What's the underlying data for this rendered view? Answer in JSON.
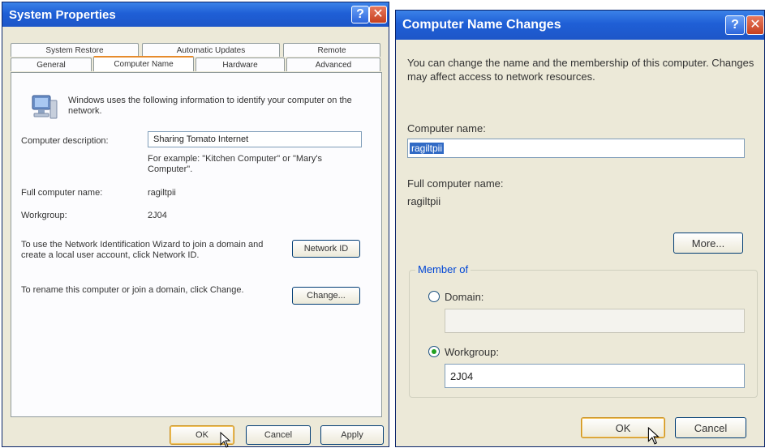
{
  "left_window": {
    "title": "System Properties",
    "tabs_row1": [
      "System Restore",
      "Automatic Updates",
      "Remote"
    ],
    "tabs_row2": [
      "General",
      "Computer Name",
      "Hardware",
      "Advanced"
    ],
    "intro_text": "Windows uses the following information to identify your computer on the network.",
    "desc_label": "Computer description:",
    "desc_value": "Sharing Tomato Internet",
    "desc_example": "For example: \"Kitchen Computer\" or \"Mary's Computer\".",
    "fullname_label": "Full computer name:",
    "fullname_value": "ragiltpii",
    "workgroup_label": "Workgroup:",
    "workgroup_value": "2J04",
    "network_text": "To use the Network Identification Wizard to join a domain and create a local user account, click Network ID.",
    "network_button": "Network ID",
    "rename_text": "To rename this computer or join a domain, click Change.",
    "change_button": "Change...",
    "ok": "OK",
    "cancel": "Cancel",
    "apply": "Apply"
  },
  "right_window": {
    "title": "Computer Name Changes",
    "intro_text": "You can change the name and the membership of this computer. Changes may affect access to network resources.",
    "name_label": "Computer name:",
    "name_value": "ragiltpii",
    "fullname_label": "Full computer name:",
    "fullname_value": "ragiltpii",
    "more_button": "More...",
    "member_of": "Member of",
    "domain_label": "Domain:",
    "domain_value": "",
    "workgroup_label": "Workgroup:",
    "workgroup_value": "2J04",
    "ok": "OK",
    "cancel": "Cancel"
  }
}
